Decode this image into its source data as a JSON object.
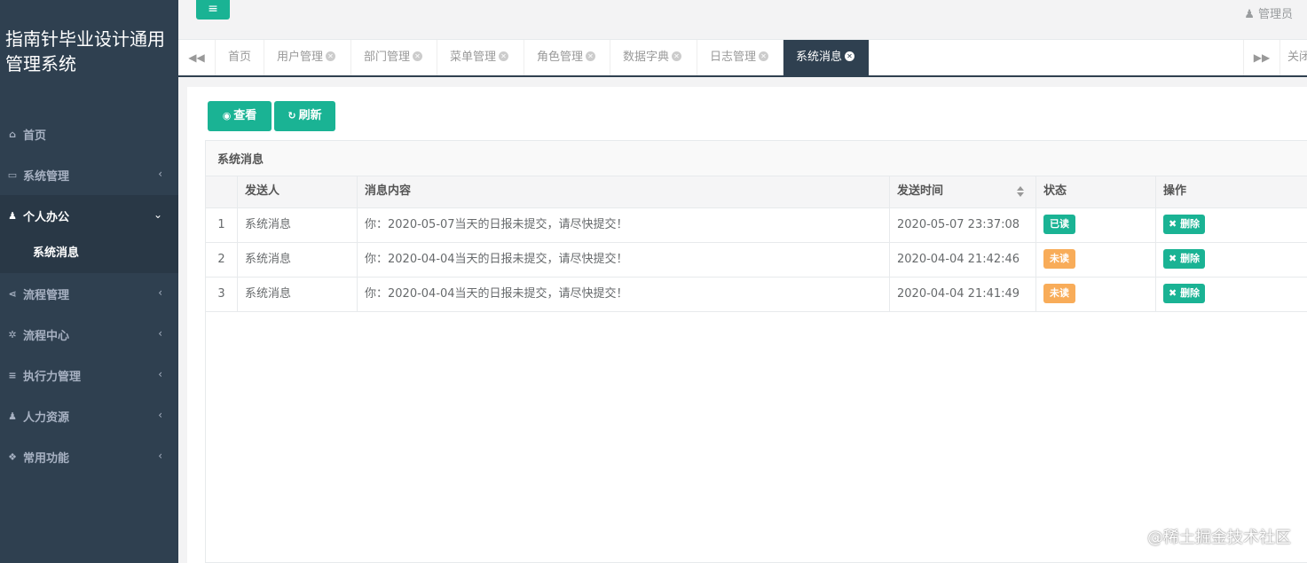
{
  "sidebar": {
    "brand": "指南针毕业设计通用管理系统",
    "items": [
      {
        "label": "首页",
        "icon": "home-icon",
        "glyph": "⌂"
      },
      {
        "label": "系统管理",
        "icon": "desktop-icon",
        "glyph": "▭"
      },
      {
        "label": "个人办公",
        "icon": "user-icon",
        "glyph": "♟"
      },
      {
        "label": "流程管理",
        "icon": "share-icon",
        "glyph": "<"
      },
      {
        "label": "流程中心",
        "icon": "gear-icon",
        "glyph": "✲"
      },
      {
        "label": "执行力管理",
        "icon": "list-icon",
        "glyph": "≡"
      },
      {
        "label": "人力资源",
        "icon": "user-plus-icon",
        "glyph": "♟"
      },
      {
        "label": "常用功能",
        "icon": "cubes-icon",
        "glyph": "❖"
      }
    ],
    "sub_item": "系统消息"
  },
  "topbar": {
    "menu_glyph": "≡",
    "user": "管理员"
  },
  "tabs": {
    "items": [
      "首页",
      "用户管理",
      "部门管理",
      "菜单管理",
      "角色管理",
      "数据字典",
      "日志管理",
      "系统消息"
    ],
    "close_label": "关闭"
  },
  "toolbar": {
    "view_label": "查看",
    "refresh_label": "刷新"
  },
  "panel": {
    "title": "系统消息",
    "columns": [
      "",
      "发送人",
      "消息内容",
      "发送时间",
      "状态",
      "操作"
    ],
    "rows": [
      {
        "idx": "1",
        "sender": "系统消息",
        "content": "你：2020-05-07当天的日报未提交，请尽快提交！",
        "time": "2020-05-07 23:37:08",
        "status": "已读",
        "op": "删除"
      },
      {
        "idx": "2",
        "sender": "系统消息",
        "content": "你：2020-04-04当天的日报未提交，请尽快提交！",
        "time": "2020-04-04 21:42:46",
        "status": "未读",
        "op": "删除"
      },
      {
        "idx": "3",
        "sender": "系统消息",
        "content": "你：2020-04-04当天的日报未提交，请尽快提交！",
        "time": "2020-04-04 21:41:49",
        "status": "未读",
        "op": "删除"
      }
    ]
  },
  "colors": {
    "sidebar": "#2f4050",
    "accent": "#1ab394",
    "warning": "#f8ac59"
  },
  "watermark": "@稀土掘金技术社区"
}
